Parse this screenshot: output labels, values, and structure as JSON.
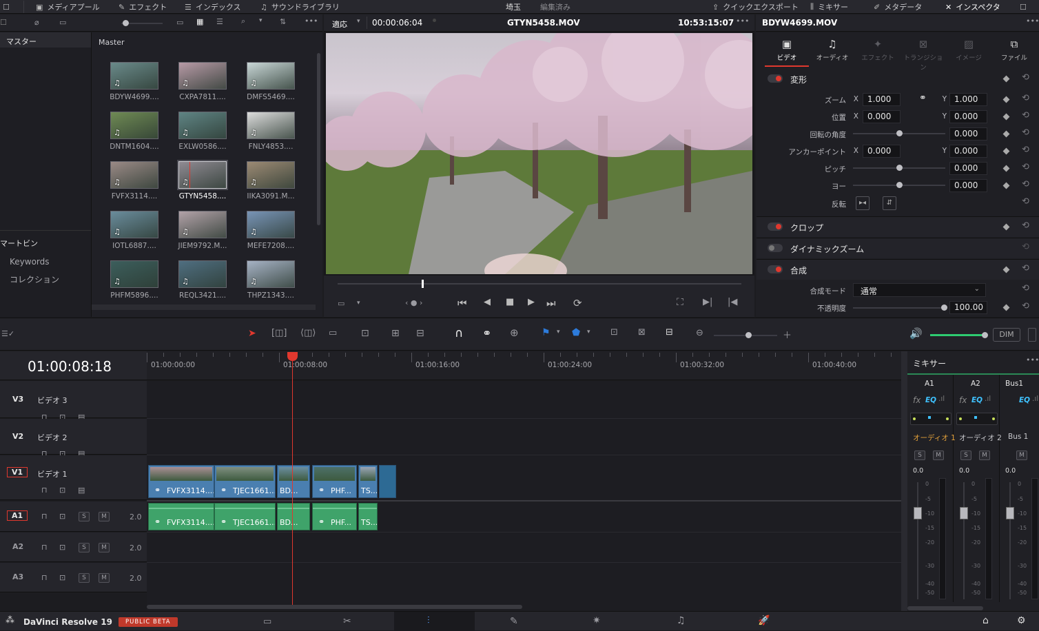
{
  "topbar": {
    "media_pool": "メディアプール",
    "effects": "エフェクト",
    "index": "インデックス",
    "sound_library": "サウンドライブラリ",
    "project": "埼玉",
    "edited": "編集済み",
    "quick_export": "クイックエクスポート",
    "mixer": "ミキサー",
    "metadata": "メタデータ",
    "inspector": "インスペクタ"
  },
  "viewer": {
    "fit": "適応",
    "timecode": "00:00:06:04",
    "clip_name": "GTYN5458.MOV",
    "record_time": "10:53:15:07"
  },
  "media_pool": {
    "sidebar_master": "マスター",
    "power_bins": "マートビン",
    "keywords": "Keywords",
    "collections": "コレクション",
    "bin_title": "Master",
    "clips": [
      {
        "name": "BDYW4699....",
        "color": "#6a8a8a"
      },
      {
        "name": "CXPA7811....",
        "color": "#b79aa6"
      },
      {
        "name": "DMFS5469....",
        "color": "#c8d6d6"
      },
      {
        "name": "DNTM1604....",
        "color": "#6f8a54"
      },
      {
        "name": "EXLW0586....",
        "color": "#5f8484"
      },
      {
        "name": "FNLY4853....",
        "color": "#dcdcdc"
      },
      {
        "name": "FVFX3114....",
        "color": "#9a8a86"
      },
      {
        "name": "GTYN5458....",
        "color": "#8f8a92"
      },
      {
        "name": "IIKA3091.M...",
        "color": "#9c8a74"
      },
      {
        "name": "IOTL6887....",
        "color": "#6a8c9c"
      },
      {
        "name": "JIEM9792.M...",
        "color": "#b2a2a8"
      },
      {
        "name": "MEFE7208....",
        "color": "#7894b6"
      },
      {
        "name": "PHFM5896....",
        "color": "#3c5e5c"
      },
      {
        "name": "REQL3421....",
        "color": "#4f6e80"
      },
      {
        "name": "THPZ1343....",
        "color": "#a6b2c4"
      }
    ]
  },
  "inspector": {
    "clip": "BDYW4699.MOV",
    "tabs": [
      "ビデオ",
      "オーディオ",
      "エフェクト",
      "トランジション",
      "イメージ",
      "ファイル"
    ],
    "transform": "変形",
    "zoom": "ズーム",
    "zoom_x": "1.000",
    "zoom_y": "1.000",
    "position": "位置",
    "pos_x": "0.000",
    "pos_y": "0.000",
    "rotation": "回転の角度",
    "rotation_val": "0.000",
    "anchor": "アンカーポイント",
    "anchor_x": "0.000",
    "anchor_y": "0.000",
    "pitch": "ピッチ",
    "pitch_val": "0.000",
    "yaw": "ヨー",
    "yaw_val": "0.000",
    "flip": "反転",
    "crop": "クロップ",
    "dynamic_zoom": "ダイナミックズーム",
    "composite": "合成",
    "blend_mode_label": "合成モード",
    "blend_mode": "通常",
    "opacity_label": "不透明度",
    "opacity": "100.00",
    "x": "X",
    "y": "Y"
  },
  "timeline": {
    "timecode": "01:00:08:18",
    "ruler": [
      "01:00:00:00",
      "01:00:08:00",
      "01:00:16:00",
      "01:00:24:00",
      "01:00:32:00",
      "01:00:40:00"
    ],
    "tracks": {
      "v3": "V3",
      "v3_name": "ビデオ 3",
      "v2": "V2",
      "v2_name": "ビデオ 2",
      "v1": "V1",
      "v1_name": "ビデオ 1",
      "a1": "A1",
      "a2": "A2",
      "a3": "A3",
      "a_level": "2.0",
      "solo": "S",
      "mute": "M"
    },
    "video_clips": [
      "FVFX3114....",
      "TJEC1661....",
      "BD...",
      "PHF...",
      "TS..."
    ],
    "audio_clips": [
      "FVFX3114....",
      "TJEC1661....",
      "BD...",
      "PHF...",
      "TS..."
    ],
    "dim": "DIM"
  },
  "mixer": {
    "title": "ミキサー",
    "channels": [
      "A1",
      "A2",
      "Bus1"
    ],
    "names": [
      "オーディオ 1",
      "オーディオ 2",
      "Bus 1"
    ],
    "levels": [
      "0.0",
      "0.0",
      "0.0"
    ],
    "fx": "fx",
    "eq": "EQ",
    "scale": [
      "0",
      "-5",
      "-10",
      "-15",
      "-20",
      "-30",
      "-40",
      "-50"
    ]
  },
  "footer": {
    "app": "DaVinci Resolve 19",
    "badge": "PUBLIC BETA"
  },
  "colors": {
    "accent_red": "#e0382e",
    "video_clip": "#4a7fb0",
    "audio_clip": "#3fa36a",
    "playhead": "#e0382e",
    "mixer_level": "#2ecc71"
  }
}
